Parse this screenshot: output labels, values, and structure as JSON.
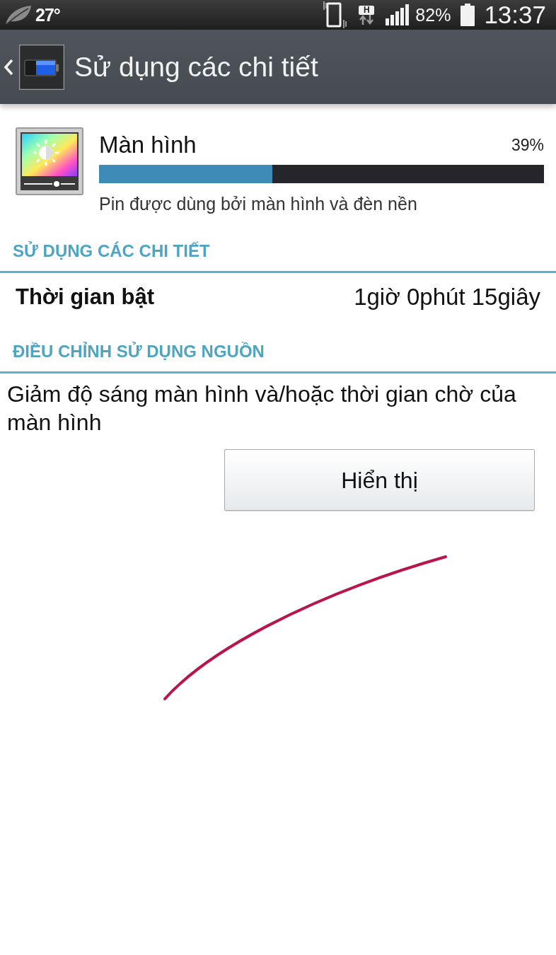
{
  "status_bar": {
    "temperature": "27°",
    "network_type": "H",
    "battery_percent": "82%",
    "time": "13:37"
  },
  "action_bar": {
    "title": "Sử dụng các chi tiết"
  },
  "usage_item": {
    "name": "Màn hình",
    "percent": "39%",
    "level": 0.39,
    "description": "Pin được dùng bởi màn hình và đèn nền"
  },
  "sections": [
    {
      "kind": "details",
      "header": "SỬ DỤNG CÁC CHI TIẾT",
      "rows": [
        {
          "label": "Thời gian bật",
          "value": "1giờ 0phút 15giây"
        }
      ]
    },
    {
      "kind": "advice",
      "header": "ĐIỀU CHỈNH SỬ DỤNG NGUỒN",
      "text": "Giảm độ sáng màn hình và/hoặc thời gian chờ của màn hình",
      "button": "Hiển thị"
    }
  ]
}
